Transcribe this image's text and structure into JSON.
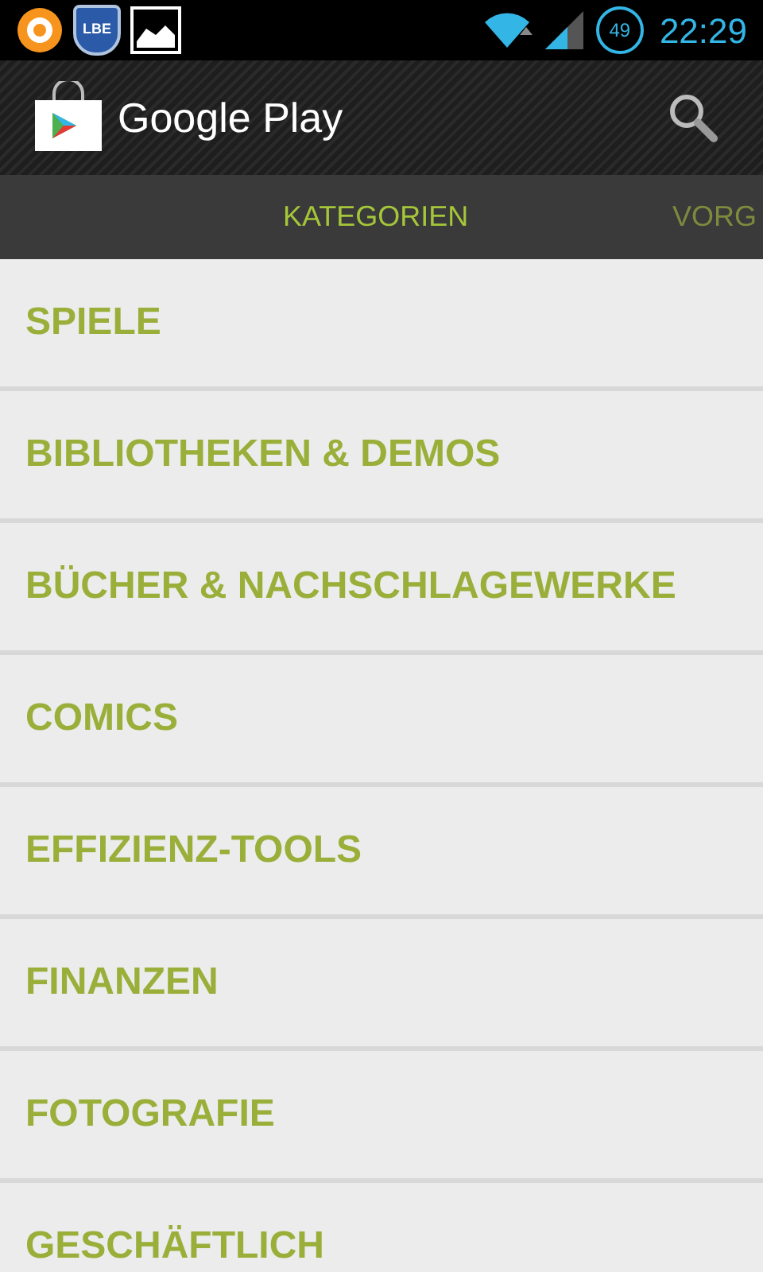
{
  "status_bar": {
    "notification_badge": "LBE",
    "battery": "49",
    "time": "22:29"
  },
  "action_bar": {
    "title": "Google Play"
  },
  "tabs": [
    {
      "label": "KATEGORIEN",
      "selected": true
    },
    {
      "label": "VORG",
      "selected": false
    }
  ],
  "categories": [
    "SPIELE",
    "BIBLIOTHEKEN & DEMOS",
    "BÜCHER & NACHSCHLAGEWERKE",
    "COMICS",
    "EFFIZIENZ-TOOLS",
    "FINANZEN",
    "FOTOGRAFIE",
    "GESCHÄFTLICH"
  ]
}
